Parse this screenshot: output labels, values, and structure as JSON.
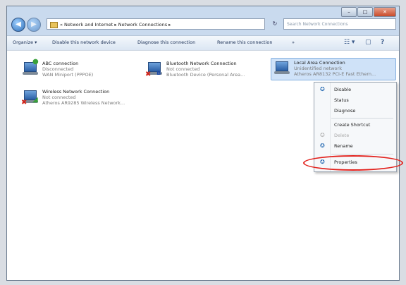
{
  "window": {
    "caption_buttons": {
      "minimize": "–",
      "maximize": "□",
      "close": "✕"
    }
  },
  "address_bar": {
    "back_glyph": "◀",
    "forward_glyph": "▶",
    "path": "« Network and Internet ▸ Network Connections ▸",
    "refresh_glyph": "↻",
    "search_placeholder": "Search Network Connections"
  },
  "toolbar": {
    "organize": "Organize ▾",
    "disable": "Disable this network device",
    "diagnose": "Diagnose this connection",
    "rename": "Rename this connection",
    "more": "»",
    "view_glyph": "☷ ▾",
    "pane_glyph": "▢",
    "help_glyph": "?"
  },
  "connections": [
    {
      "name": "ABC connection",
      "status": "Disconnected",
      "device": "WAN Miniport (PPPOE)",
      "badge": ""
    },
    {
      "name": "Bluetooth Network Connection",
      "status": "Not connected",
      "device": "Bluetooth Device (Personal Area...",
      "badge": "✖"
    },
    {
      "name": "Local Area Connection",
      "status": "Unidentified network",
      "device": "Atheros AR8132 PCI-E Fast Ethern...",
      "badge": ""
    },
    {
      "name": "Wireless Network Connection",
      "status": "Not connected",
      "device": "Atheros AR9285 Wireless Network...",
      "badge": "✖"
    }
  ],
  "context_menu": {
    "items": [
      {
        "label": "Disable",
        "icon": "shield-icon",
        "glyph": "✪"
      },
      {
        "label": "Status"
      },
      {
        "label": "Diagnose"
      },
      {
        "label": "Create Shortcut"
      },
      {
        "label": "Delete",
        "icon": "shield-icon",
        "glyph": "✪"
      },
      {
        "label": "Rename",
        "icon": "shield-icon",
        "glyph": "✪"
      },
      {
        "label": "Properties",
        "icon": "shield-icon",
        "glyph": "✪"
      }
    ]
  },
  "colors": {
    "accent": "#2b5fa6",
    "highlight_ring": "#e2211c",
    "badge_red": "#d4261c"
  }
}
